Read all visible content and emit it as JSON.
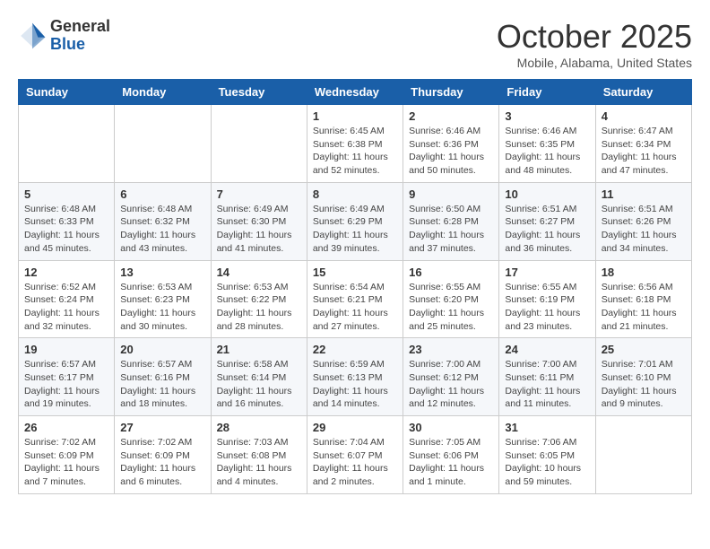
{
  "header": {
    "logo_general": "General",
    "logo_blue": "Blue",
    "month_title": "October 2025",
    "location": "Mobile, Alabama, United States"
  },
  "days_of_week": [
    "Sunday",
    "Monday",
    "Tuesday",
    "Wednesday",
    "Thursday",
    "Friday",
    "Saturday"
  ],
  "weeks": [
    [
      {
        "day": "",
        "info": ""
      },
      {
        "day": "",
        "info": ""
      },
      {
        "day": "",
        "info": ""
      },
      {
        "day": "1",
        "info": "Sunrise: 6:45 AM\nSunset: 6:38 PM\nDaylight: 11 hours\nand 52 minutes."
      },
      {
        "day": "2",
        "info": "Sunrise: 6:46 AM\nSunset: 6:36 PM\nDaylight: 11 hours\nand 50 minutes."
      },
      {
        "day": "3",
        "info": "Sunrise: 6:46 AM\nSunset: 6:35 PM\nDaylight: 11 hours\nand 48 minutes."
      },
      {
        "day": "4",
        "info": "Sunrise: 6:47 AM\nSunset: 6:34 PM\nDaylight: 11 hours\nand 47 minutes."
      }
    ],
    [
      {
        "day": "5",
        "info": "Sunrise: 6:48 AM\nSunset: 6:33 PM\nDaylight: 11 hours\nand 45 minutes."
      },
      {
        "day": "6",
        "info": "Sunrise: 6:48 AM\nSunset: 6:32 PM\nDaylight: 11 hours\nand 43 minutes."
      },
      {
        "day": "7",
        "info": "Sunrise: 6:49 AM\nSunset: 6:30 PM\nDaylight: 11 hours\nand 41 minutes."
      },
      {
        "day": "8",
        "info": "Sunrise: 6:49 AM\nSunset: 6:29 PM\nDaylight: 11 hours\nand 39 minutes."
      },
      {
        "day": "9",
        "info": "Sunrise: 6:50 AM\nSunset: 6:28 PM\nDaylight: 11 hours\nand 37 minutes."
      },
      {
        "day": "10",
        "info": "Sunrise: 6:51 AM\nSunset: 6:27 PM\nDaylight: 11 hours\nand 36 minutes."
      },
      {
        "day": "11",
        "info": "Sunrise: 6:51 AM\nSunset: 6:26 PM\nDaylight: 11 hours\nand 34 minutes."
      }
    ],
    [
      {
        "day": "12",
        "info": "Sunrise: 6:52 AM\nSunset: 6:24 PM\nDaylight: 11 hours\nand 32 minutes."
      },
      {
        "day": "13",
        "info": "Sunrise: 6:53 AM\nSunset: 6:23 PM\nDaylight: 11 hours\nand 30 minutes."
      },
      {
        "day": "14",
        "info": "Sunrise: 6:53 AM\nSunset: 6:22 PM\nDaylight: 11 hours\nand 28 minutes."
      },
      {
        "day": "15",
        "info": "Sunrise: 6:54 AM\nSunset: 6:21 PM\nDaylight: 11 hours\nand 27 minutes."
      },
      {
        "day": "16",
        "info": "Sunrise: 6:55 AM\nSunset: 6:20 PM\nDaylight: 11 hours\nand 25 minutes."
      },
      {
        "day": "17",
        "info": "Sunrise: 6:55 AM\nSunset: 6:19 PM\nDaylight: 11 hours\nand 23 minutes."
      },
      {
        "day": "18",
        "info": "Sunrise: 6:56 AM\nSunset: 6:18 PM\nDaylight: 11 hours\nand 21 minutes."
      }
    ],
    [
      {
        "day": "19",
        "info": "Sunrise: 6:57 AM\nSunset: 6:17 PM\nDaylight: 11 hours\nand 19 minutes."
      },
      {
        "day": "20",
        "info": "Sunrise: 6:57 AM\nSunset: 6:16 PM\nDaylight: 11 hours\nand 18 minutes."
      },
      {
        "day": "21",
        "info": "Sunrise: 6:58 AM\nSunset: 6:14 PM\nDaylight: 11 hours\nand 16 minutes."
      },
      {
        "day": "22",
        "info": "Sunrise: 6:59 AM\nSunset: 6:13 PM\nDaylight: 11 hours\nand 14 minutes."
      },
      {
        "day": "23",
        "info": "Sunrise: 7:00 AM\nSunset: 6:12 PM\nDaylight: 11 hours\nand 12 minutes."
      },
      {
        "day": "24",
        "info": "Sunrise: 7:00 AM\nSunset: 6:11 PM\nDaylight: 11 hours\nand 11 minutes."
      },
      {
        "day": "25",
        "info": "Sunrise: 7:01 AM\nSunset: 6:10 PM\nDaylight: 11 hours\nand 9 minutes."
      }
    ],
    [
      {
        "day": "26",
        "info": "Sunrise: 7:02 AM\nSunset: 6:09 PM\nDaylight: 11 hours\nand 7 minutes."
      },
      {
        "day": "27",
        "info": "Sunrise: 7:02 AM\nSunset: 6:09 PM\nDaylight: 11 hours\nand 6 minutes."
      },
      {
        "day": "28",
        "info": "Sunrise: 7:03 AM\nSunset: 6:08 PM\nDaylight: 11 hours\nand 4 minutes."
      },
      {
        "day": "29",
        "info": "Sunrise: 7:04 AM\nSunset: 6:07 PM\nDaylight: 11 hours\nand 2 minutes."
      },
      {
        "day": "30",
        "info": "Sunrise: 7:05 AM\nSunset: 6:06 PM\nDaylight: 11 hours\nand 1 minute."
      },
      {
        "day": "31",
        "info": "Sunrise: 7:06 AM\nSunset: 6:05 PM\nDaylight: 10 hours\nand 59 minutes."
      },
      {
        "day": "",
        "info": ""
      }
    ]
  ]
}
